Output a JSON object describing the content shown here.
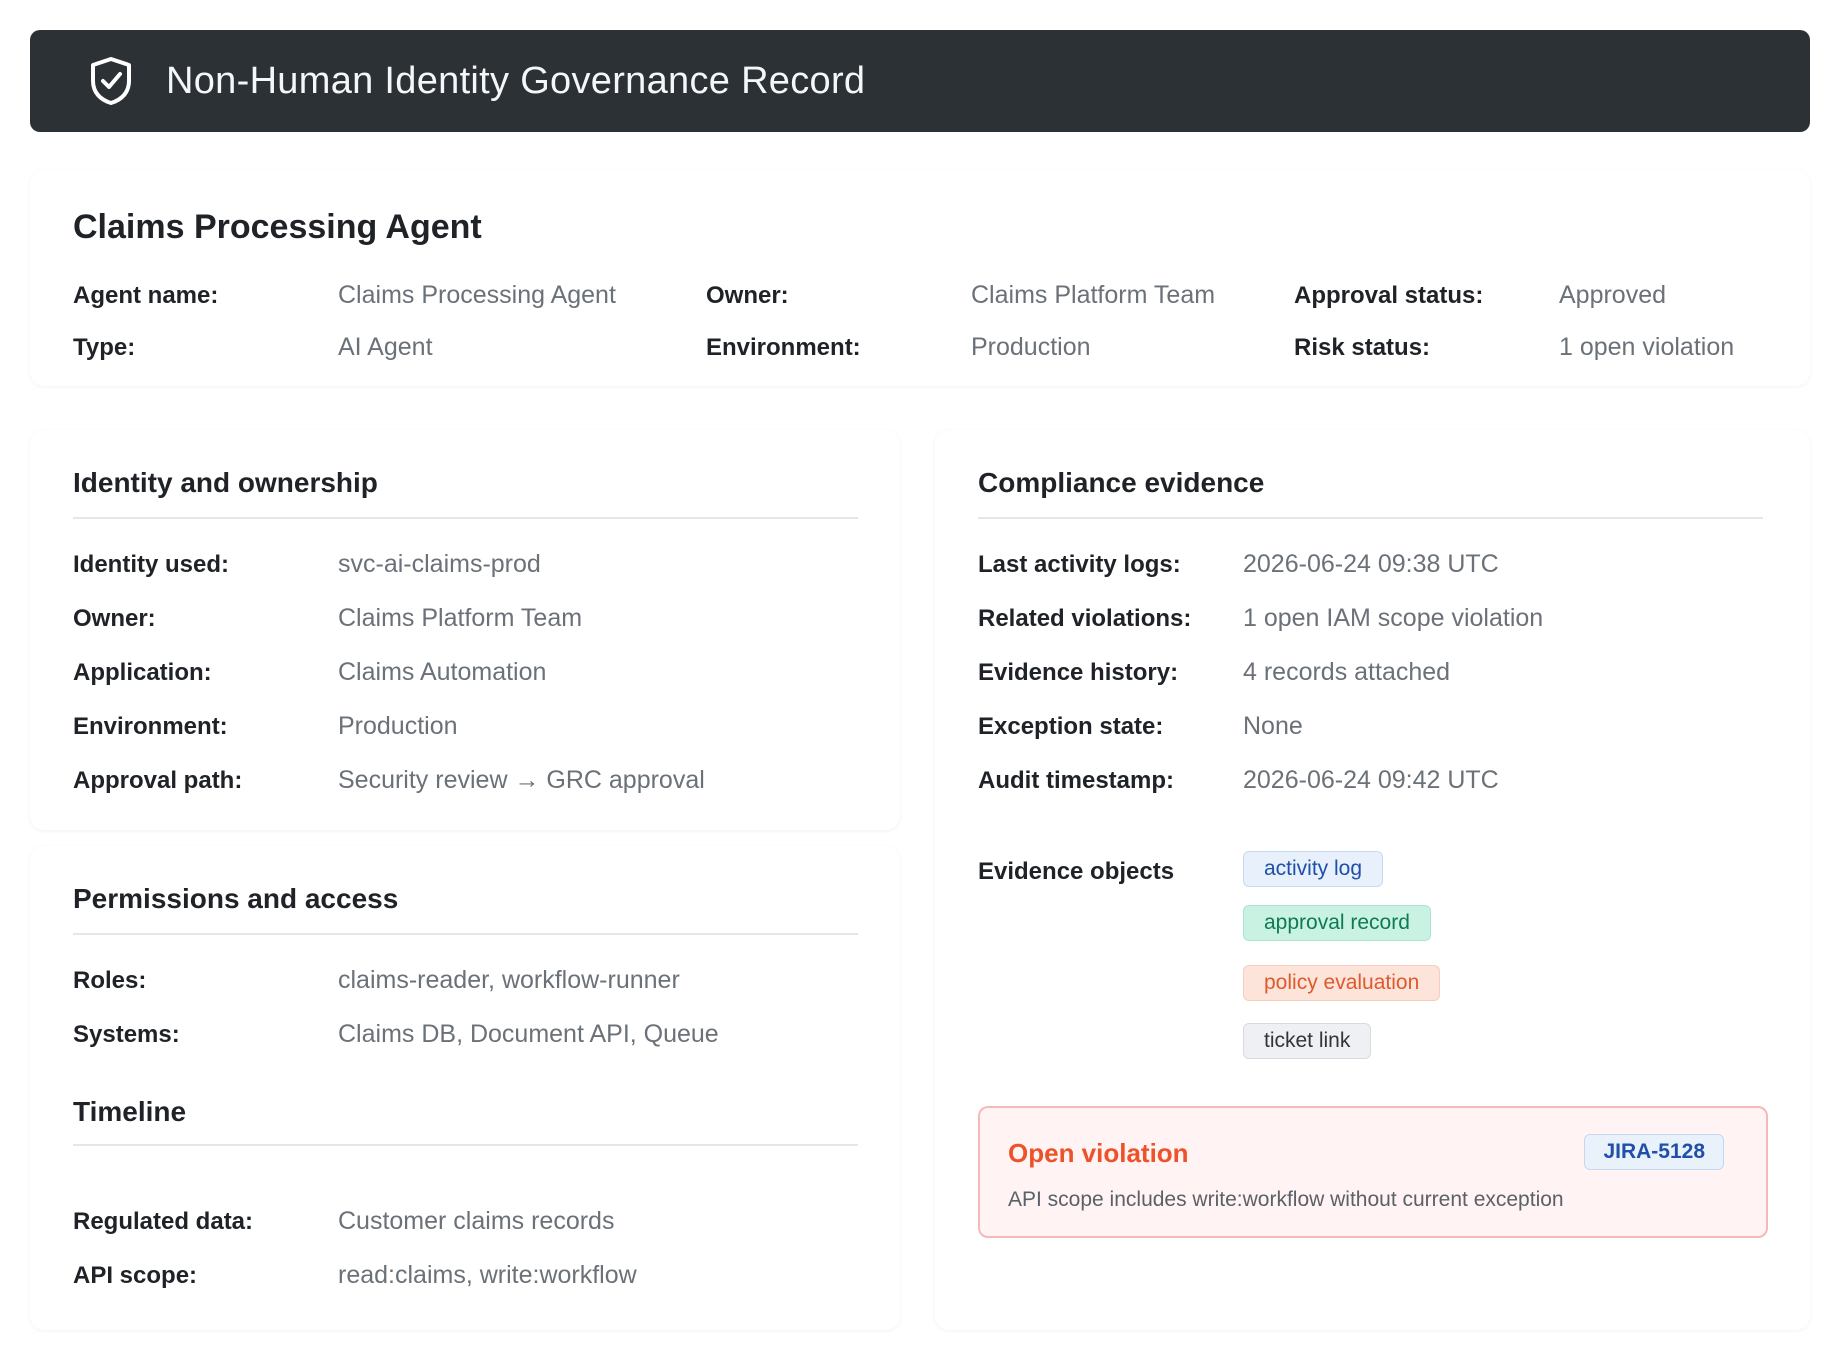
{
  "header": {
    "title": "Non-Human Identity Governance Record",
    "icon": "shield-check-icon"
  },
  "summary": {
    "agent_title": "Claims Processing Agent",
    "fields": [
      {
        "label": "Agent name:",
        "value": "Claims Processing Agent"
      },
      {
        "label": "Type:",
        "value": "AI Agent"
      },
      {
        "label": "Owner:",
        "value": "Claims Platform Team"
      },
      {
        "label": "Environment:",
        "value": "Production"
      },
      {
        "label": "Approval status:",
        "value": "Approved"
      },
      {
        "label": "Risk status:",
        "value": "1 open violation"
      }
    ]
  },
  "identity": {
    "title": "Identity and ownership",
    "fields": [
      {
        "label": "Identity used:",
        "value": "svc-ai-claims-prod"
      },
      {
        "label": "Owner:",
        "value": "Claims Platform Team"
      },
      {
        "label": "Application:",
        "value": "Claims Automation"
      },
      {
        "label": "Environment:",
        "value": "Production"
      },
      {
        "label": "Approval path:",
        "value": "Security review → GRC approval"
      }
    ]
  },
  "permissions": {
    "title": "Permissions and access",
    "fields": [
      {
        "label": "Roles:",
        "value": "claims-reader, workflow-runner"
      },
      {
        "label": "Systems:",
        "value": "Claims DB, Document API, Queue"
      }
    ]
  },
  "timeline": {
    "title": "Timeline",
    "fields": [
      {
        "label": "Regulated data:",
        "value": "Customer claims records"
      },
      {
        "label": "API scope:",
        "value": "read:claims, write:workflow"
      }
    ]
  },
  "compliance": {
    "title": "Compliance evidence",
    "fields": [
      {
        "label": "Last activity logs:",
        "value": "2026-06-24 09:38 UTC"
      },
      {
        "label": "Related violations:",
        "value": "1 open IAM scope violation"
      },
      {
        "label": "Evidence history:",
        "value": "4 records attached"
      },
      {
        "label": "Exception state:",
        "value": "None"
      },
      {
        "label": "Audit timestamp:",
        "value": "2026-06-24 09:42 UTC"
      }
    ],
    "evidence_label": "Evidence objects",
    "evidence_objects": [
      "activity log",
      "approval record",
      "policy evaluation",
      "ticket link"
    ]
  },
  "violation": {
    "title": "Open violation",
    "ticket": "JIRA-5128",
    "description": "API scope includes write:workflow without current exception"
  },
  "colors": {
    "header_bg": "#2c3136",
    "violation_accent": "#ec532b",
    "chip_blue": "#1f4fa8",
    "chip_green": "#0e7a55",
    "chip_orange": "#dd5a2c"
  }
}
